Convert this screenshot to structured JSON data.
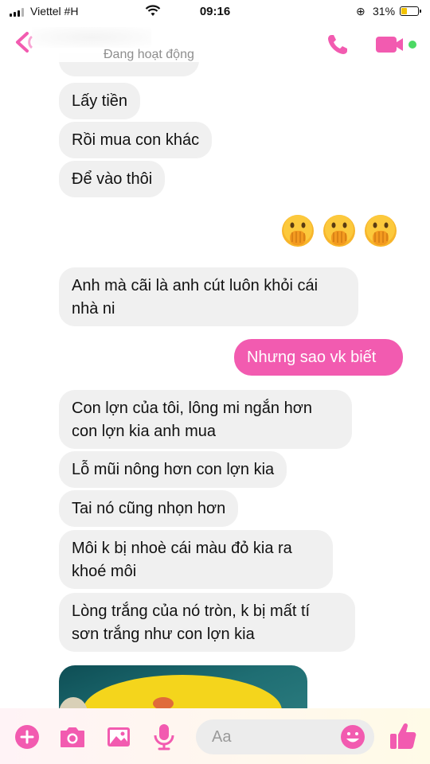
{
  "status_bar": {
    "carrier": "Viettel #H",
    "time": "09:16",
    "battery_percent": "31%",
    "battery_level": 0.31
  },
  "header": {
    "active_status": "Đang hoạt động"
  },
  "messages": [
    {
      "side": "in",
      "text": "Lấy tiền"
    },
    {
      "side": "in",
      "text": "Rồi mua con khác"
    },
    {
      "side": "in",
      "text": "Để vào thôi"
    },
    {
      "side": "in",
      "text": "Anh mà cãi là anh cút luôn khỏi cái\nnhà ni"
    },
    {
      "side": "out",
      "text": "Nhưng sao vk biết"
    },
    {
      "side": "in",
      "text": "Con lợn của tôi, lông mi ngắn hơn\ncon lợn kia anh mua"
    },
    {
      "side": "in",
      "text": "Lỗ mũi nông hơn con lợn kia"
    },
    {
      "side": "in",
      "text": "Tai nó cũng nhọn hơn"
    },
    {
      "side": "in",
      "text": "Môi k bị nhoè cái màu đỏ kia ra\nkhoé môi"
    },
    {
      "side": "in",
      "text": "Lòng trắng của nó tròn, k bị mất tí\nsơn trắng như con lợn kia"
    }
  ],
  "emoji_reactions": [
    "face-with-hand-over-mouth",
    "face-with-hand-over-mouth",
    "face-with-hand-over-mouth"
  ],
  "composer": {
    "placeholder": "Aa"
  },
  "colors": {
    "accent": "#f25bb0",
    "incoming_bubble": "#f0f0f0",
    "outgoing_bubble": "#f25bb0"
  },
  "icons": [
    "back-icon",
    "call-icon",
    "video-icon",
    "plus-icon",
    "camera-icon",
    "image-icon",
    "microphone-icon",
    "emoji-icon",
    "thumbs-up-icon"
  ]
}
